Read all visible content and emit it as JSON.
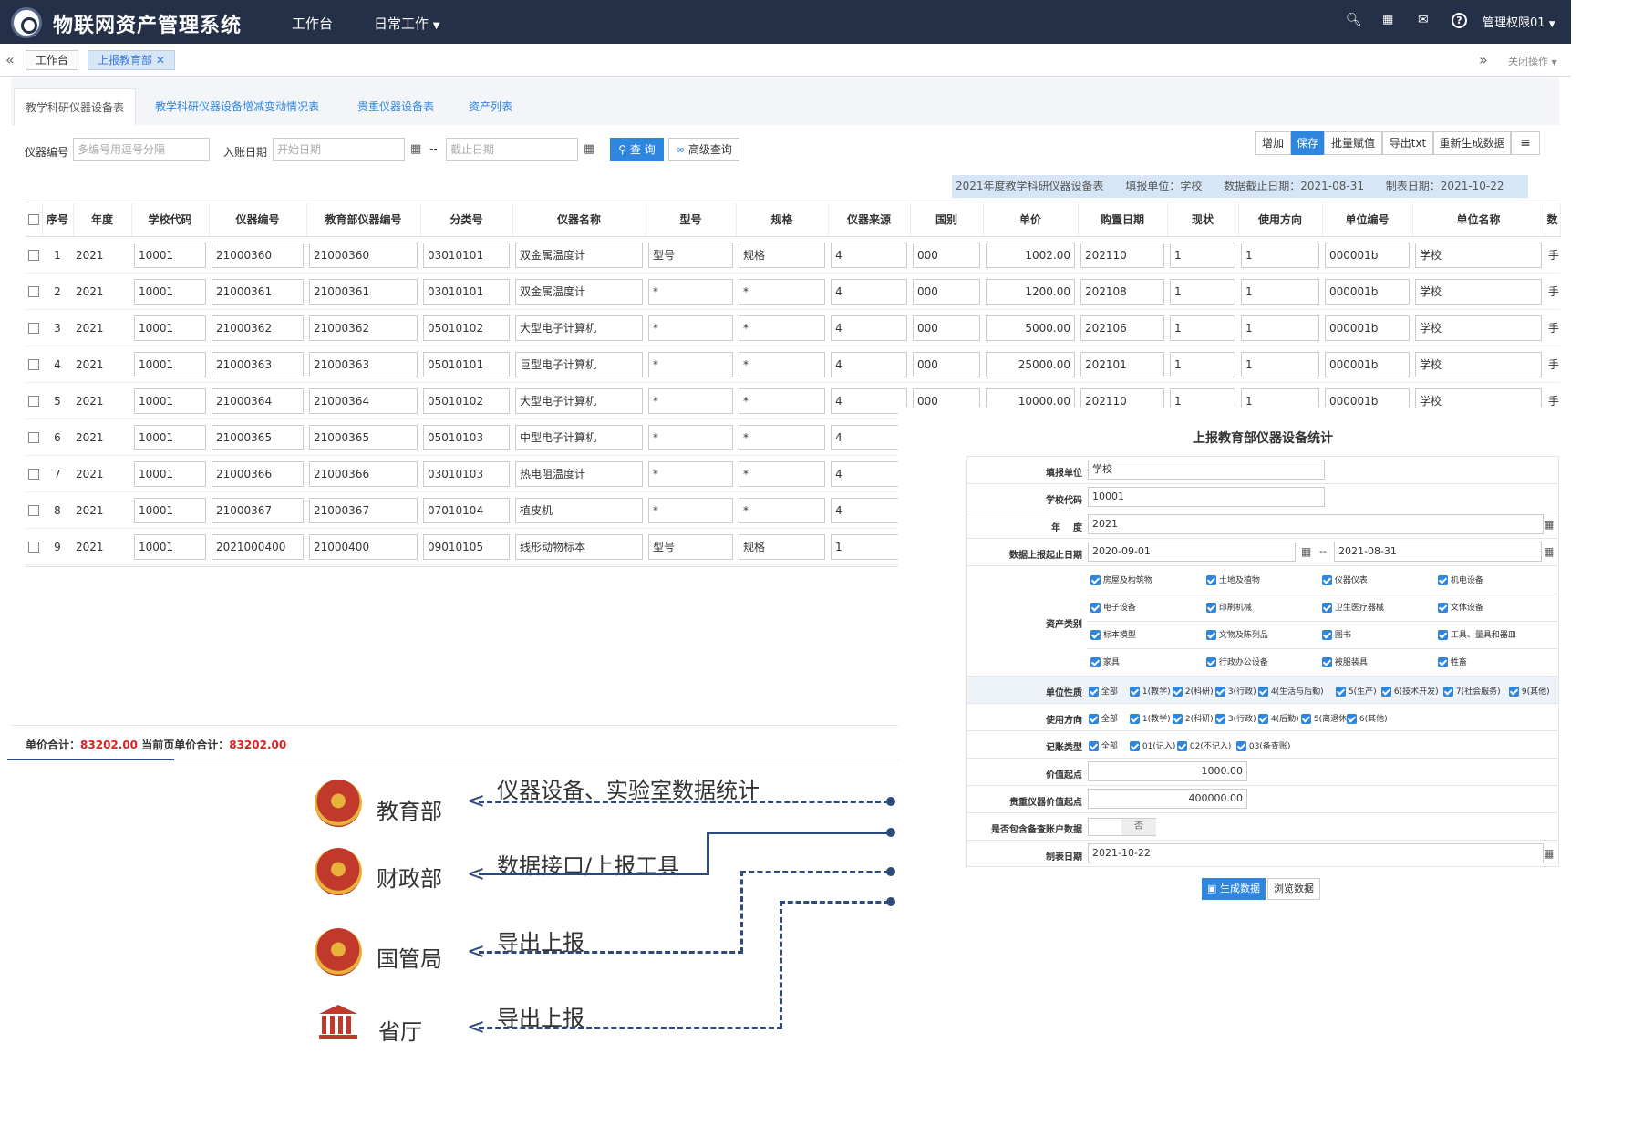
{
  "header": {
    "app_title": "物联网资产管理系统",
    "nav": [
      "工作台",
      "日常工作"
    ],
    "user": "管理权限01"
  },
  "tabs": {
    "home": "工作台",
    "current": "上报教育部",
    "close_ops": "关闭操作"
  },
  "subtabs": [
    "教学科研仪器设备表",
    "教学科研仪器设备增减变动情况表",
    "贵重仪器设备表",
    "资产列表"
  ],
  "search": {
    "id_label": "仪器编号",
    "id_placeholder": "多编号用逗号分隔",
    "date_label": "入账日期",
    "start_placeholder": "开始日期",
    "end_placeholder": "截止日期",
    "query_btn": "查 询",
    "advanced_btn": "高级查询"
  },
  "toolbar": [
    "增加",
    "保存",
    "批量赋值",
    "导出txt",
    "重新生成数据"
  ],
  "info_bar": {
    "title": "2021年度教学科研仪器设备表",
    "unit": "填报单位：学校",
    "cutoff": "数据截止日期：2021-08-31",
    "made": "制表日期：2021-10-22"
  },
  "table": {
    "headers": [
      "序号",
      "年度",
      "学校代码",
      "仪器编号",
      "教育部仪器编号",
      "分类号",
      "仪器名称",
      "型号",
      "规格",
      "仪器来源",
      "国别",
      "单价",
      "购置日期",
      "现状",
      "使用方向",
      "单位编号",
      "单位名称",
      "数"
    ],
    "rows": [
      [
        "1",
        "2021",
        "10001",
        "21000360",
        "21000360",
        "03010101",
        "双金属温度计",
        "型号",
        "规格",
        "4",
        "000",
        "1002.00",
        "202110",
        "1",
        "1",
        "000001b",
        "学校",
        "手"
      ],
      [
        "2",
        "2021",
        "10001",
        "21000361",
        "21000361",
        "03010101",
        "双金属温度计",
        "*",
        "*",
        "4",
        "000",
        "1200.00",
        "202108",
        "1",
        "1",
        "000001b",
        "学校",
        "手"
      ],
      [
        "3",
        "2021",
        "10001",
        "21000362",
        "21000362",
        "05010102",
        "大型电子计算机",
        "*",
        "*",
        "4",
        "000",
        "5000.00",
        "202106",
        "1",
        "1",
        "000001b",
        "学校",
        "手"
      ],
      [
        "4",
        "2021",
        "10001",
        "21000363",
        "21000363",
        "05010101",
        "巨型电子计算机",
        "*",
        "*",
        "4",
        "000",
        "25000.00",
        "202101",
        "1",
        "1",
        "000001b",
        "学校",
        "手"
      ],
      [
        "5",
        "2021",
        "10001",
        "21000364",
        "21000364",
        "05010102",
        "大型电子计算机",
        "*",
        "*",
        "4",
        "000",
        "10000.00",
        "202110",
        "1",
        "1",
        "000001b",
        "学校",
        "手"
      ],
      [
        "6",
        "2021",
        "10001",
        "21000365",
        "21000365",
        "05010103",
        "中型电子计算机",
        "*",
        "*",
        "4"
      ],
      [
        "7",
        "2021",
        "10001",
        "21000366",
        "21000366",
        "03010103",
        "热电阻温度计",
        "*",
        "*",
        "4"
      ],
      [
        "8",
        "2021",
        "10001",
        "21000367",
        "21000367",
        "07010104",
        "植皮机",
        "*",
        "*",
        "4"
      ],
      [
        "9",
        "2021",
        "10001",
        "2021000400",
        "21000400",
        "09010105",
        "线形动物标本",
        "型号",
        "规格",
        "1"
      ]
    ]
  },
  "totals": {
    "label1": "单价合计：",
    "value1": "83202.00",
    "label2": "当前页单价合计：",
    "value2": "83202.00"
  },
  "form": {
    "title": "上报教育部仪器设备统计",
    "unit_label": "填报单位",
    "unit_value": "学校",
    "code_label": "学校代码",
    "code_value": "10001",
    "year_label": "年    度",
    "year_value": "2021",
    "range_label": "数据上报起止日期",
    "range_start": "2020-09-01",
    "range_end": "2021-08-31",
    "asset_label": "资产类别",
    "asset_types": [
      "房屋及构筑物",
      "土地及植物",
      "仪器仪表",
      "机电设备",
      "电子设备",
      "印刷机械",
      "卫生医疗器械",
      "文体设备",
      "标本模型",
      "文物及陈列品",
      "图书",
      "工具、量具和器皿",
      "家具",
      "行政办公设备",
      "被服装具",
      "牲畜"
    ],
    "nature_label": "单位性质",
    "nature_opts": [
      "全部",
      "1(教学)",
      "2(科研)",
      "3(行政)",
      "4(生活与后勤)",
      "5(生产)",
      "6(技术开发)",
      "7(社会服务)",
      "9(其他)"
    ],
    "direction_label": "使用方向",
    "direction_opts": [
      "全部",
      "1(教学)",
      "2(科研)",
      "3(行政)",
      "4(后勤)",
      "5(离退休)",
      "6(其他)"
    ],
    "record_label": "记账类型",
    "record_opts": [
      "全部",
      "01(记入)",
      "02(不记入)",
      "03(备查账)"
    ],
    "price_label": "价值起点",
    "price_value": "1000.00",
    "precious_label": "贵重仪器价值起点",
    "precious_value": "400000.00",
    "include_label": "是否包含备查账户数据",
    "include_value": "否",
    "date_label": "制表日期",
    "date_value": "2021-10-22",
    "gen_btn": "生成数据",
    "browse_btn": "浏览数据"
  },
  "flow": {
    "depts": [
      "教育部",
      "财政部",
      "国管局",
      "省厅"
    ],
    "labels": [
      "仪器设备、实验室数据统计",
      "数据接口/上报工具",
      "导出上报",
      "导出上报"
    ]
  },
  "colors": {
    "topbar": "#243047",
    "accent": "#2e86de",
    "total_value": "#e02020",
    "flow_line": "#2d4a7a",
    "emblem_red": "#c0392b"
  }
}
